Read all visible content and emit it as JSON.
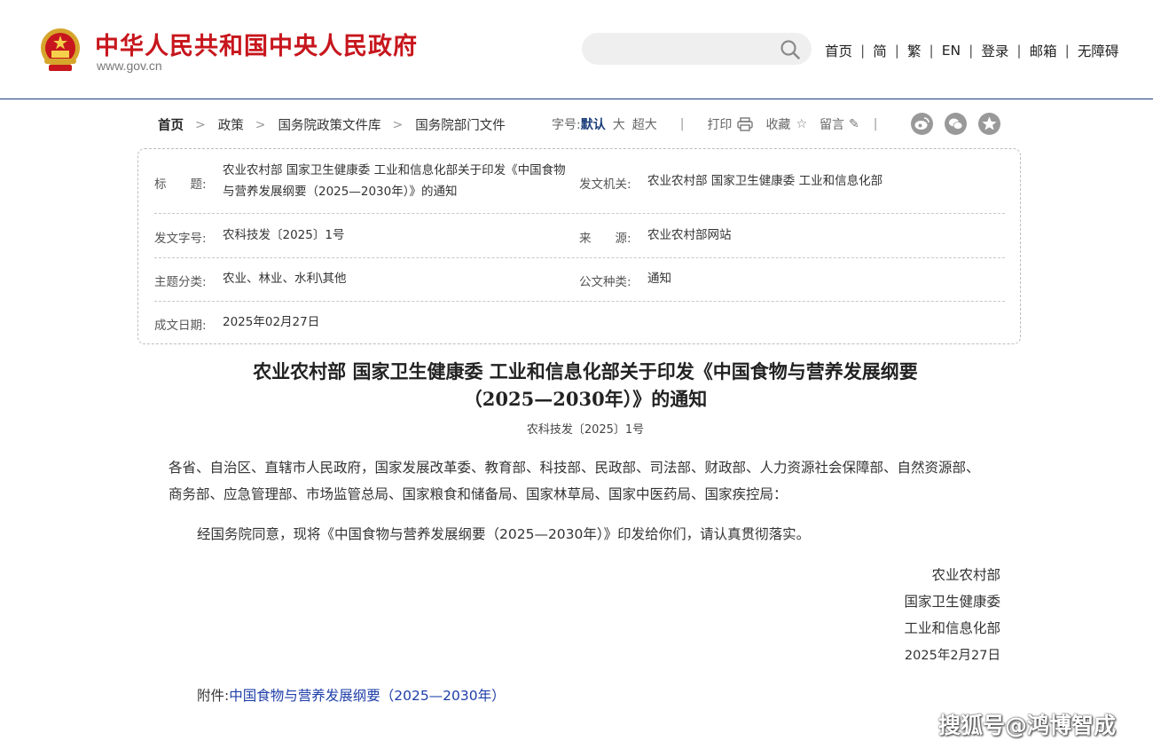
{
  "header": {
    "site_title": "中华人民共和国中央人民政府",
    "site_domain": "www.gov.cn",
    "search_placeholder": "",
    "nav": [
      "首页",
      "简",
      "繁",
      "EN",
      "登录",
      "邮箱",
      "无障碍"
    ],
    "colors": {
      "brand_red": "#c7161d",
      "nav_blue": "#1b3f7a"
    }
  },
  "breadcrumb": [
    "首页",
    "政策",
    "国务院政策文件库",
    "国务院部门文件"
  ],
  "tools": {
    "font_label": "字号:",
    "font_default": "默认",
    "font_large": "大",
    "font_xlarge": "超大",
    "print": "打印",
    "favorite": "收藏",
    "comment": "留言",
    "share_icons": [
      "weibo-icon",
      "wechat-icon",
      "qzone-icon"
    ]
  },
  "info": {
    "title_label": "标　　题:",
    "title_value": "农业农村部 国家卫生健康委 工业和信息化部关于印发《中国食物与营养发展纲要（2025—2030年）》的通知",
    "issuer_label": "发文机关:",
    "issuer_value": "农业农村部 国家卫生健康委 工业和信息化部",
    "docno_label": "发文字号:",
    "docno_value": "农科技发〔2025〕1号",
    "source_label": "来　　源:",
    "source_value": "农业农村部网站",
    "topic_label": "主题分类:",
    "topic_value": "农业、林业、水利\\其他",
    "type_label": "公文种类:",
    "type_value": "通知",
    "date_label": "成文日期:",
    "date_value": "2025年02月27日"
  },
  "document": {
    "title_line1": "农业农村部 国家卫生健康委 工业和信息化部关于印发《中国食物与营养发展纲要",
    "title_line2": "（2025—2030年）》的通知",
    "doc_number": "农科技发〔2025〕1号",
    "recipients": "各省、自治区、直辖市人民政府，国家发展改革委、教育部、科技部、民政部、司法部、财政部、人力资源社会保障部、自然资源部、商务部、应急管理部、市场监管总局、国家粮食和储备局、国家林草局、国家中医药局、国家疾控局：",
    "body": "经国务院同意，现将《中国食物与营养发展纲要（2025—2030年）》印发给你们，请认真贯彻落实。",
    "signatories": [
      "农业农村部",
      "国家卫生健康委",
      "工业和信息化部"
    ],
    "sign_date": "2025年2月27日",
    "attachment_label": "附件:",
    "attachment_link": "中国食物与营养发展纲要（2025—2030年）"
  },
  "watermark": "搜狐号@鸿博智成"
}
